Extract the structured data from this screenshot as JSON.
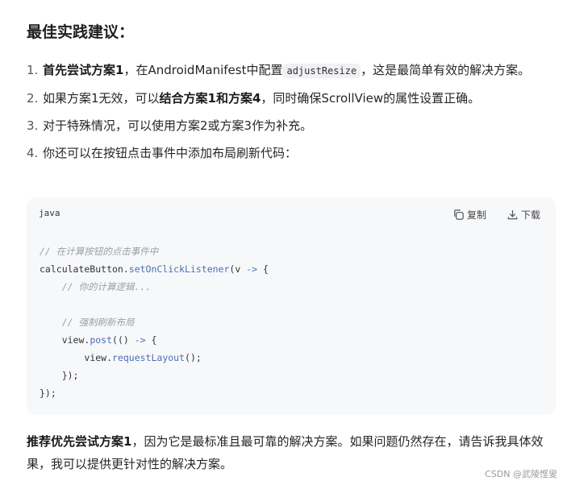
{
  "heading": "最佳实践建议：",
  "list": [
    {
      "num": "1.",
      "bold1": "首先尝试方案1",
      "t1": "，在AndroidManifest中配置",
      "code": "adjustResize",
      "t2": "，这是最简单有效的解决方案。"
    },
    {
      "num": "2.",
      "t1": "如果方案1无效，可以",
      "bold1": "结合方案1和方案4",
      "t2": "，同时确保ScrollView的属性设置正确。"
    },
    {
      "num": "3.",
      "t1": "对于特殊情况，可以使用方案2或方案3作为补充。"
    },
    {
      "num": "4.",
      "t1": "你还可以在按钮点击事件中添加布局刷新代码："
    }
  ],
  "code_block": {
    "language": "java",
    "copy_label": "复制",
    "download_label": "下载",
    "comment1": "// 在计算按钮的点击事件中",
    "line_obj": "calculateButton.",
    "line_method": "setOnClickListener",
    "line_args": "(v ",
    "arrow": "->",
    "line_open": " {",
    "comment2": "// 你的计算逻辑...",
    "comment3": "// 强制刷新布局",
    "post_obj": "view.",
    "post_method": "post",
    "post_args": "(() ",
    "post_open": " {",
    "rl_obj": "view.",
    "rl_method": "requestLayout",
    "rl_end": "();",
    "close_inner": "});",
    "close_outer": "});"
  },
  "footer": {
    "bold": "推荐优先尝试方案1",
    "text": "，因为它是最标准且最可靠的解决方案。如果问题仍然存在，请告诉我具体效果，我可以提供更针对性的解决方案。"
  },
  "watermark": "CSDN @武陵悭叟"
}
